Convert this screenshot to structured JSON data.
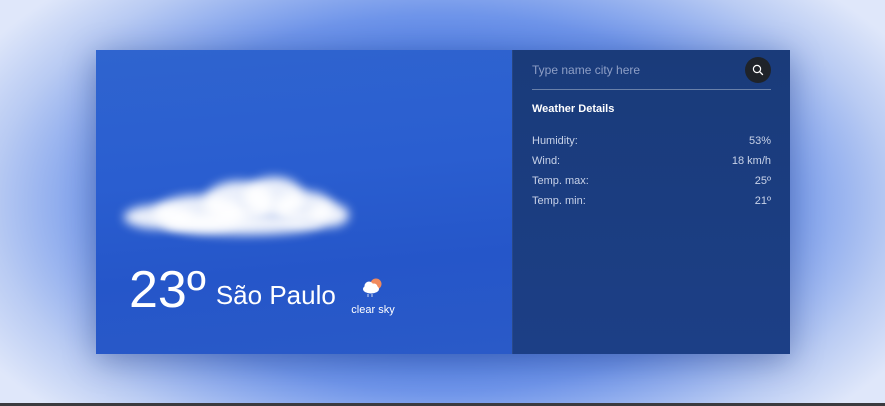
{
  "weather": {
    "temperature": "23º",
    "city": "São Paulo",
    "condition": "clear sky",
    "condition_icon": "cloud-sun-icon"
  },
  "search": {
    "placeholder": "Type name city here",
    "icon": "search-icon"
  },
  "details": {
    "title": "Weather Details",
    "rows": [
      {
        "label": "Humidity:",
        "value": "53%"
      },
      {
        "label": "Wind:",
        "value": "18 km/h"
      },
      {
        "label": "Temp. max:",
        "value": "25º"
      },
      {
        "label": "Temp. min:",
        "value": "21º"
      }
    ]
  },
  "colors": {
    "panel_bg": "#1b3d80",
    "hero_bg": "#2a5ed0",
    "search_button": "#1f2329"
  }
}
